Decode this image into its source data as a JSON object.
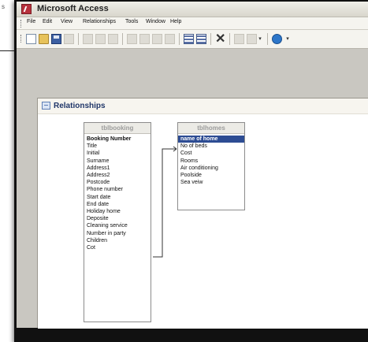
{
  "page_fragment": {
    "text": "s"
  },
  "window": {
    "title": "Microsoft Access"
  },
  "menubar": {
    "items": [
      "File",
      "Edit",
      "View",
      "Relationships",
      "Tools",
      "Window",
      "Help"
    ]
  },
  "toolbar": {
    "icons": [
      "new-icon",
      "open-icon",
      "save-icon",
      "print-icon",
      "cut-icon",
      "copy-icon",
      "paste-icon",
      "undo-icon",
      "show-table-icon",
      "grid-icon",
      "delete-icon",
      "relationships-icon",
      "new-object-icon",
      "help-icon"
    ]
  },
  "relationships_window": {
    "title": "Relationships"
  },
  "tables": [
    {
      "name": "tblbooking",
      "fields": [
        "Booking Number",
        "Title",
        "Initial",
        "Surname",
        "Address1",
        "Address2",
        "Postcode",
        "Phone number",
        "Start date",
        "End date",
        "Holiday home",
        "Deposite",
        "Cleaning service",
        "Number in party",
        "Children",
        "Cot"
      ]
    },
    {
      "name": "tblhomes",
      "fields": [
        "name of home",
        "No of beds",
        "Cost",
        "Rooms",
        "Air conditioning",
        "Poolside",
        "Sea veiw"
      ]
    }
  ],
  "colors": {
    "selected_field_bg": "#2d4c93",
    "access_red": "#b7313c",
    "workspace_gray": "#c9c7c1"
  }
}
